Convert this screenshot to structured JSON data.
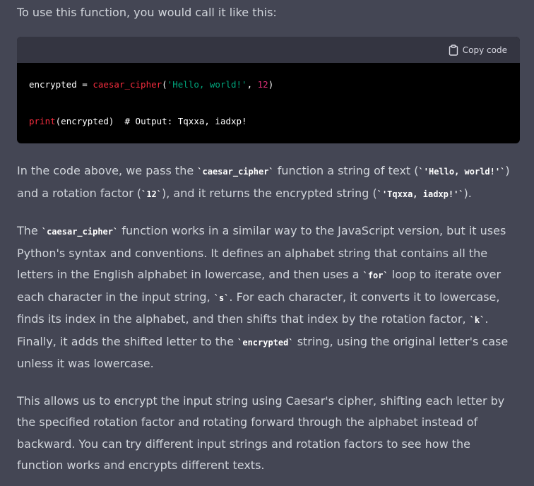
{
  "intro": "To use this function, you would call it like this:",
  "code_block": {
    "copy_label": "Copy code",
    "copy_icon": "clipboard-icon",
    "line1": {
      "var": "encrypted = ",
      "fn": "caesar_cipher",
      "open": "(",
      "str": "'Hello, world!'",
      "comma": ", ",
      "num": "12",
      "close": ")"
    },
    "line2": {
      "fn": "print",
      "args": "(encrypted)",
      "comment": "  # Output: Tqxxa, iadxp!"
    }
  },
  "p1": {
    "t1": "In the code above, we pass the ",
    "c1": "`caesar_cipher`",
    "t2": " function a string of text (",
    "c2": "`'Hello, world!'`",
    "t3": ") and a rotation factor (",
    "c3": "`12`",
    "t4": "), and it returns the encrypted string (",
    "c4": "`'Tqxxa, iadxp!'`",
    "t5": ")."
  },
  "p2": {
    "t1": "The ",
    "c1": "`caesar_cipher`",
    "t2": " function works in a similar way to the JavaScript version, but it uses Python's syntax and conventions. It defines an alphabet string that contains all the letters in the English alphabet in lowercase, and then uses a ",
    "c2": "`for`",
    "t3": " loop to iterate over each character in the input string, ",
    "c3": "`s`",
    "t4": ". For each character, it converts it to lowercase, finds its index in the alphabet, and then shifts that index by the rotation factor, ",
    "c4": "`k`",
    "t5": ". Finally, it adds the shifted letter to the ",
    "c5": "`encrypted`",
    "t6": " string, using the original letter's case unless it was lowercase."
  },
  "p3": "This allows us to encrypt the input string using Caesar's cipher, shifting each letter by the specified rotation factor and rotating forward through the alphabet instead of backward. You can try different input strings and rotation factors to see how the function works and encrypts different texts.",
  "colors": {
    "background": "#444654",
    "text": "#d1d5db",
    "code_bg": "#000000",
    "code_header_bg": "#343541",
    "fn": "#f22c3d",
    "string": "#00a67d",
    "number": "#df3079"
  }
}
